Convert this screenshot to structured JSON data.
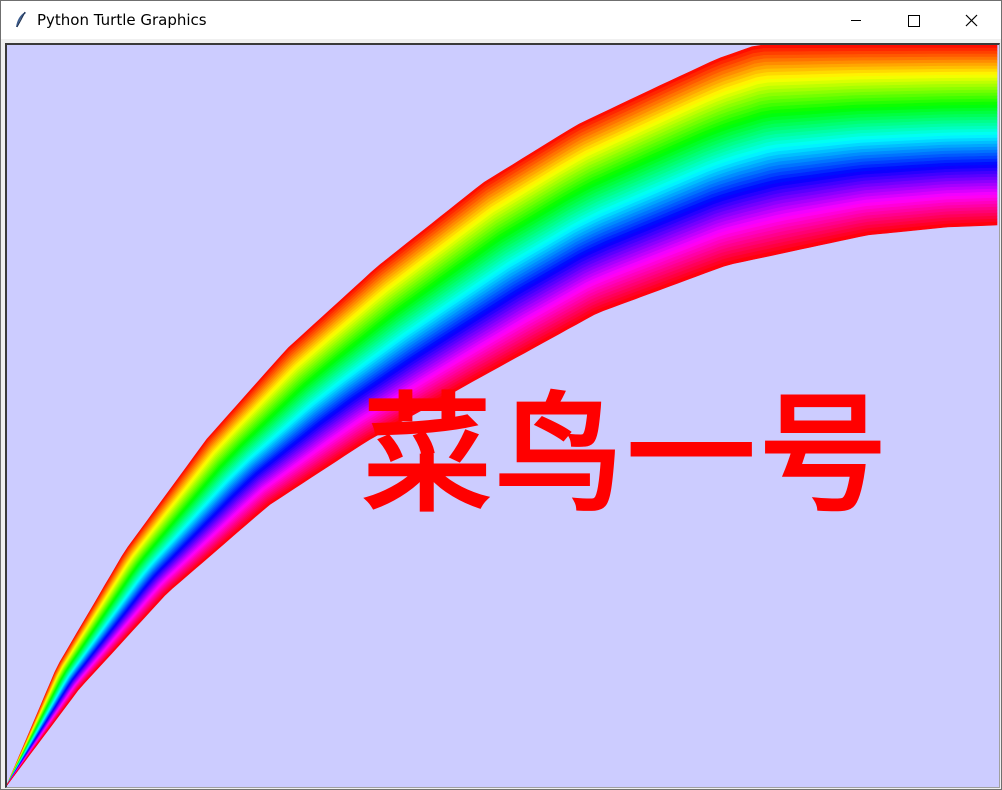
{
  "window": {
    "title": "Python Turtle Graphics",
    "app_icon": "feather-icon",
    "controls": {
      "minimize_icon": "minimize-icon",
      "maximize_icon": "maximize-icon",
      "close_icon": "close-icon"
    }
  },
  "canvas": {
    "background": "#ccccff",
    "caption": "菜鸟一号",
    "caption_color": "#ff0000",
    "rainbow_colors": [
      "#ff0000",
      "#ffff00",
      "#00ff00",
      "#00ffff",
      "#0000ff",
      "#ff00ff",
      "#ff0000"
    ]
  }
}
